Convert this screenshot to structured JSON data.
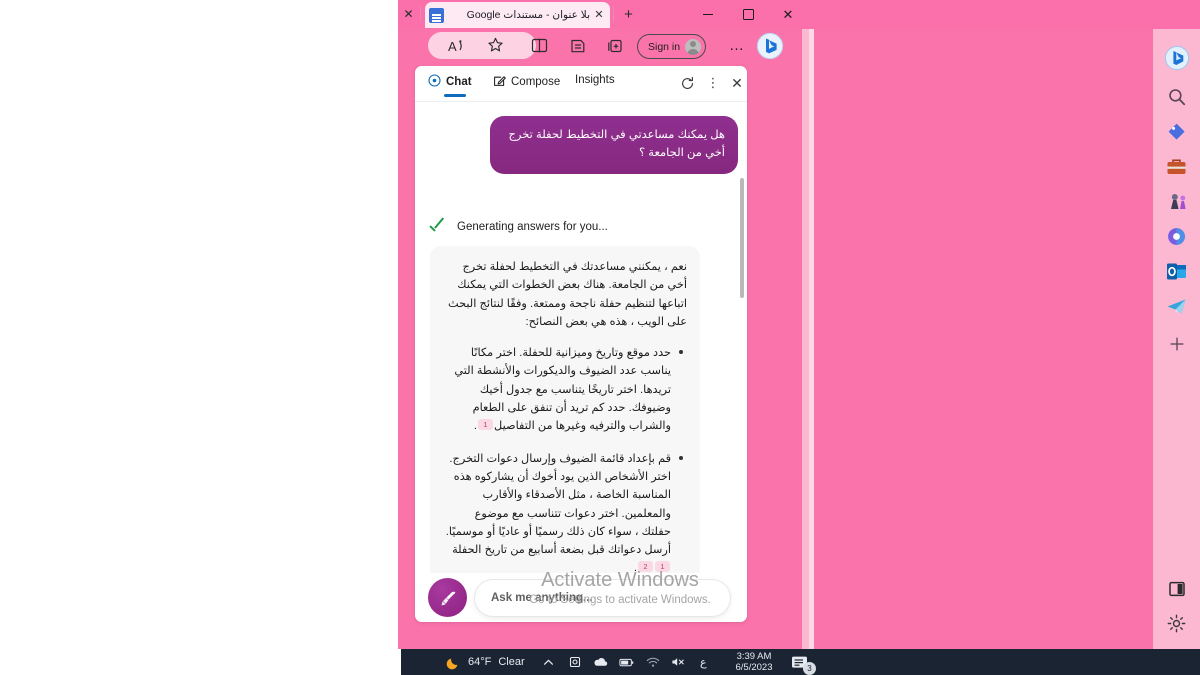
{
  "browser": {
    "tab": {
      "title": "بلا عنوان - مستندات Google",
      "close_label": "✕",
      "left_close_label": "✕",
      "new_tab_label": "+"
    },
    "window_controls": {
      "minimize": "—",
      "restore": "❐",
      "close": "✕"
    },
    "toolbar": {
      "read_aloud": "A",
      "sign_in_label": "Sign in",
      "more_label": "…"
    }
  },
  "chat": {
    "tabs": [
      {
        "label": "Chat",
        "icon": "chat-bubble-icon",
        "active": true
      },
      {
        "label": "Compose",
        "icon": "compose-pencil-icon",
        "active": false
      },
      {
        "label": "Insights",
        "icon": "",
        "active": false
      }
    ],
    "header_actions": {
      "refresh": "⟳",
      "kebab": "⋮",
      "close": "✕"
    },
    "user_message": "هل يمكنك مساعدتي في التخطيط لحفلة تخرج أخي من الجامعة ؟",
    "status_text": "Generating answers for you...",
    "response": {
      "intro": "نعم ، يمكنني مساعدتك في التخطيط لحفلة تخرج أخي من الجامعة. هناك بعض الخطوات التي يمكنك اتباعها لتنظيم حفلة ناجحة وممتعة. وفقًا لنتائج البحث على الويب ، هذه هي بعض النصائح:",
      "bullets": [
        {
          "text": "حدد موقع وتاريخ وميزانية للحفلة. اختر مكانًا يناسب عدد الضيوف والديكورات والأنشطة التي تريدها. اختر تاريخًا يتناسب مع جدول أخيك وضيوفك. حدد كم تريد أن تنفق على الطعام والشراب والترفيه وغيرها من التفاصيل",
          "citations": [
            "1"
          ],
          "tail": "."
        },
        {
          "text": "قم بإعداد قائمة الضيوف وإرسال دعوات التخرج. اختر الأشخاص الذين يود أخوك أن يشاركوه هذه المناسبة الخاصة ، مثل الأصدقاء والأقارب والمعلمين. اختر دعوات تتناسب مع موضوع حفلتك ، سواء كان ذلك رسميًا أو عاديًا أو موسميًا. أرسل دعواتك قبل بضعة أسابيع من تاريخ الحفلة",
          "citations": [
            "1",
            "2"
          ],
          "tail": "."
        }
      ]
    },
    "composer": {
      "placeholder": "Ask me anything...",
      "sweep_icon": "broom-icon"
    }
  },
  "rail": {
    "items": [
      {
        "name": "bing-copilot-icon"
      },
      {
        "name": "search-icon"
      },
      {
        "name": "shopping-tag-icon"
      },
      {
        "name": "tools-briefcase-icon"
      },
      {
        "name": "games-icon"
      },
      {
        "name": "designer-icon"
      },
      {
        "name": "outlook-icon"
      },
      {
        "name": "telegram-icon"
      },
      {
        "name": "add-icon"
      }
    ],
    "bottom_items": [
      {
        "name": "split-screen-icon"
      },
      {
        "name": "settings-gear-icon"
      }
    ]
  },
  "watermark": {
    "line1": "Activate Windows",
    "line2": "Go to Settings to activate Windows."
  },
  "taskbar": {
    "temperature": "64°F",
    "condition": "Clear",
    "ime": "ع",
    "time": "3:39 AM",
    "date": "6/5/2023",
    "notification_count": "3",
    "chevron": "︿"
  },
  "colors": {
    "browser_pink": "#fb73ab",
    "rail_pink": "#fbb8d0",
    "user_bubble": "#8b2c8b",
    "accent_blue": "#0f6cbd",
    "check_green": "#1f9b4b",
    "citation_bg": "#fad9e4",
    "taskbar": "#1b2433"
  }
}
